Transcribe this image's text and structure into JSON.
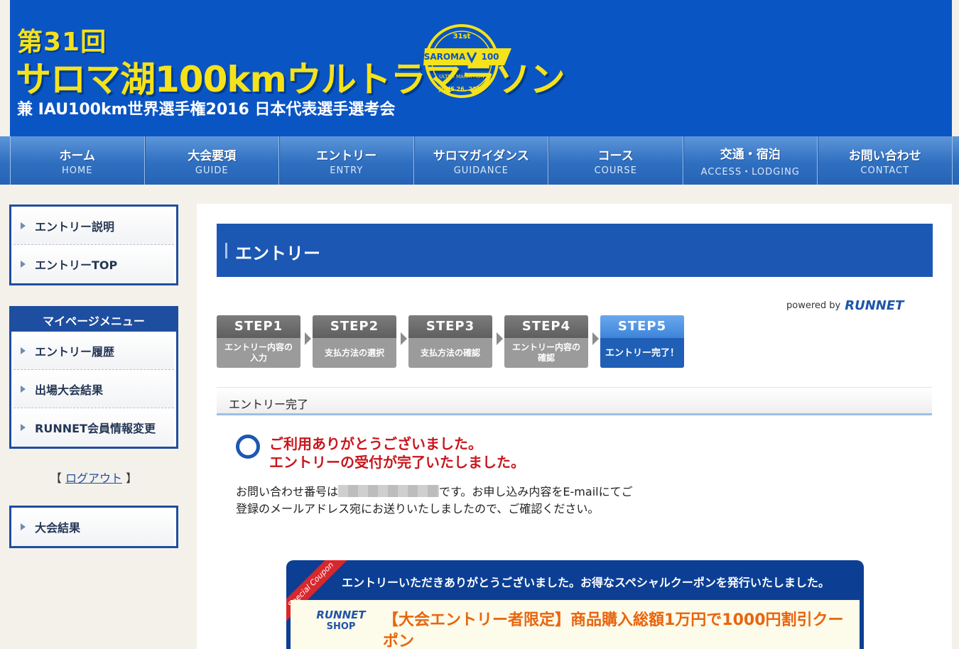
{
  "header": {
    "title_line1": "第31回",
    "title_line2": "サロマ湖100kmウルトラマラソン",
    "title_line3": "兼 IAU100km世界選手権2016 日本代表選手選考会",
    "logo": {
      "edition": "31st",
      "name": "SAROMA",
      "distance": "100",
      "subtitle": "ULTRA MARATHON",
      "date": "JUNE 26, 2016"
    }
  },
  "nav": [
    {
      "jp": "ホーム",
      "en": "HOME"
    },
    {
      "jp": "大会要項",
      "en": "GUIDE"
    },
    {
      "jp": "エントリー",
      "en": "ENTRY"
    },
    {
      "jp": "サロマガイダンス",
      "en": "GUIDANCE"
    },
    {
      "jp": "コース",
      "en": "COURSE"
    },
    {
      "jp": "交通・宿泊",
      "en": "ACCESS・LODGING"
    },
    {
      "jp": "お問い合わせ",
      "en": "CONTACT"
    }
  ],
  "sidebar": {
    "entry_links": [
      "エントリー説明",
      "エントリーTOP"
    ],
    "mypage_title": "マイページメニュー",
    "mypage_links": [
      "エントリー履歴",
      "出場大会結果",
      "RUNNET会員情報変更"
    ],
    "logout_open": "【",
    "logout": "ログアウト",
    "logout_close": "】",
    "results_link": "大会結果"
  },
  "main": {
    "title": "エントリー",
    "powered_by": "powered by",
    "runnet": "RUNNET",
    "steps": [
      {
        "label": "STEP1",
        "desc": "エントリー内容の入力"
      },
      {
        "label": "STEP2",
        "desc": "支払方法の選択"
      },
      {
        "label": "STEP3",
        "desc": "支払方法の確認"
      },
      {
        "label": "STEP4",
        "desc": "エントリー内容の確認"
      },
      {
        "label": "STEP5",
        "desc": "エントリー完了！"
      }
    ],
    "section_title": "エントリー完了",
    "thanks_line1": "ご利用ありがとうございました。",
    "thanks_line2": "エントリーの受付が完了いたしました。",
    "info_line1_pre": "お問い合わせ番号は",
    "info_line1_post": "です。お申し込み内容をE-mailにてご",
    "info_line2": "登録のメールアドレス宛にお送りいたしましたので、ご確認ください。",
    "coupon": {
      "ribbon": "Special Coupon",
      "header": "エントリーいただきありがとうございました。お得なスペシャルクーポンを発行いたしました。",
      "shop_line1": "RUNNET",
      "shop_line2": "SHOP",
      "title": "【大会エントリー者限定】商品購入総額1万円で1000円割引クーポン"
    }
  },
  "colors": {
    "header_blue": "#0a55c4",
    "title_yellow": "#f6e21a",
    "nav_blue": "#2f6fc0",
    "accent_red": "#c9161d",
    "coupon_orange": "#e8650f"
  }
}
